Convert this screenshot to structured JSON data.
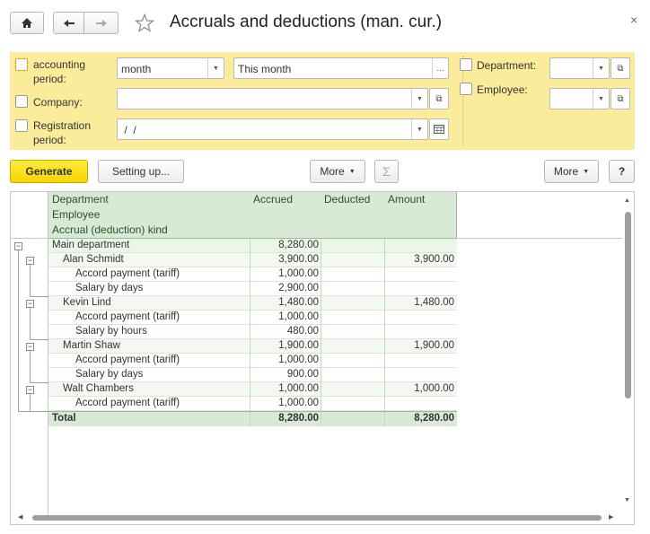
{
  "window": {
    "title": "Accruals and deductions (man. cur.)"
  },
  "filters": {
    "period": {
      "label": "accounting\nperiod:",
      "type_value": "month",
      "value": "This month"
    },
    "company": {
      "label": "Company:",
      "value": ""
    },
    "registration": {
      "label": "Registration\nperiod:",
      "value": " /  /"
    },
    "department": {
      "label": "Department:",
      "value": ""
    },
    "employee": {
      "label": "Employee:",
      "value": ""
    }
  },
  "toolbar": {
    "generate": "Generate",
    "setting": "Setting up...",
    "more1": "More",
    "sigma": "Σ",
    "more2": "More",
    "help": "?"
  },
  "report": {
    "headers": {
      "group": [
        "Department",
        "Employee",
        "Accrual (deduction) kind"
      ],
      "accrued": "Accrued",
      "deducted": "Deducted",
      "amount": "Amount"
    },
    "rows": [
      {
        "level": 0,
        "name": "Main department",
        "accrued": "8,280.00",
        "deducted": "",
        "amount": ""
      },
      {
        "level": 1,
        "name": "Alan Schmidt",
        "accrued": "3,900.00",
        "deducted": "",
        "amount": "3,900.00"
      },
      {
        "level": 2,
        "name": "Accord payment (tariff)",
        "accrued": "1,000.00",
        "deducted": "",
        "amount": ""
      },
      {
        "level": 2,
        "name": "Salary by days",
        "accrued": "2,900.00",
        "deducted": "",
        "amount": ""
      },
      {
        "level": 1,
        "name": "Kevin Lind",
        "accrued": "1,480.00",
        "deducted": "",
        "amount": "1,480.00"
      },
      {
        "level": 2,
        "name": "Accord payment (tariff)",
        "accrued": "1,000.00",
        "deducted": "",
        "amount": ""
      },
      {
        "level": 2,
        "name": "Salary by hours",
        "accrued": "480.00",
        "deducted": "",
        "amount": ""
      },
      {
        "level": 1,
        "name": "Martin Shaw",
        "accrued": "1,900.00",
        "deducted": "",
        "amount": "1,900.00"
      },
      {
        "level": 2,
        "name": "Accord payment (tariff)",
        "accrued": "1,000.00",
        "deducted": "",
        "amount": ""
      },
      {
        "level": 2,
        "name": "Salary by days",
        "accrued": "900.00",
        "deducted": "",
        "amount": ""
      },
      {
        "level": 1,
        "name": "Walt Chambers",
        "accrued": "1,000.00",
        "deducted": "",
        "amount": "1,000.00"
      },
      {
        "level": 2,
        "name": "Accord payment (tariff)",
        "accrued": "1,000.00",
        "deducted": "",
        "amount": ""
      }
    ],
    "total": {
      "name": "Total",
      "accrued": "8,280.00",
      "deducted": "",
      "amount": "8,280.00"
    }
  }
}
